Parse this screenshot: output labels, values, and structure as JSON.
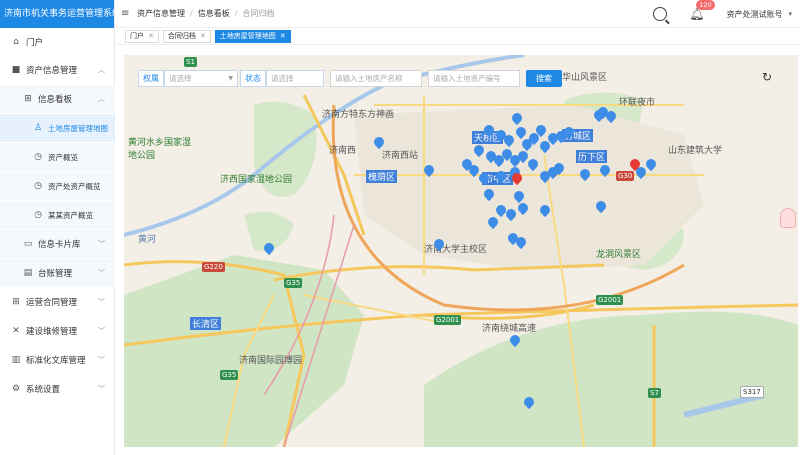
{
  "app": {
    "title": "济南市机关事务运营管理系统"
  },
  "sidebar": {
    "items": [
      {
        "label": "门户",
        "icon": "home-icon"
      },
      {
        "label": "资产信息管理",
        "icon": "car-icon"
      },
      {
        "label": "信息看板",
        "icon": "grid-icon"
      },
      {
        "label": "土地房屋管理地图",
        "icon": "user-icon"
      },
      {
        "label": "资产概览",
        "icon": "clock-icon"
      },
      {
        "label": "资产处资产概览",
        "icon": "clock-icon"
      },
      {
        "label": "某某资产概览",
        "icon": "clock-icon"
      },
      {
        "label": "信息卡片库",
        "icon": "monitor-icon"
      },
      {
        "label": "台账管理",
        "icon": "document-icon"
      },
      {
        "label": "运营合同管理",
        "icon": "grid-icon"
      },
      {
        "label": "建设维修管理",
        "icon": "tools-icon"
      },
      {
        "label": "标准化文库管理",
        "icon": "library-icon"
      },
      {
        "label": "系统设置",
        "icon": "gear-icon"
      }
    ]
  },
  "header": {
    "breadcrumb": [
      "资产信息管理",
      "信息看板",
      "合同归档"
    ],
    "notifications": "120",
    "user": "资产处测试账号"
  },
  "tabs": [
    {
      "label": "门户"
    },
    {
      "label": "合同归档"
    },
    {
      "label": "土地房屋管理地图"
    }
  ],
  "filter": {
    "ownership_label": "权属",
    "ownership_placeholder": "请选择",
    "status_label": "状态",
    "status_placeholder": "请选择",
    "name_placeholder": "请输入土地房产名称",
    "code_placeholder": "请输入土地资产编号",
    "search_label": "搜索"
  },
  "map": {
    "labels": [
      "华山风景区",
      "环联夜市",
      "济南方特东方神画",
      "天桥区",
      "历城区",
      "济南西站",
      "历下区",
      "黄河水乡国家湿地公园",
      "济西国家湿地公园",
      "槐荫区",
      "市中区",
      "山东建筑大学",
      "济南大学主校区",
      "龙洞风景区",
      "长清区",
      "济南国际园博园",
      "济南绕城高速",
      "黄河",
      "济南西"
    ],
    "shields": [
      "S1",
      "G220",
      "G35",
      "G2001",
      "G2001",
      "G35",
      "S7",
      "S317",
      "G30"
    ]
  },
  "colors": {
    "accent": "#1e88e5",
    "pin": "#3d8de8"
  }
}
